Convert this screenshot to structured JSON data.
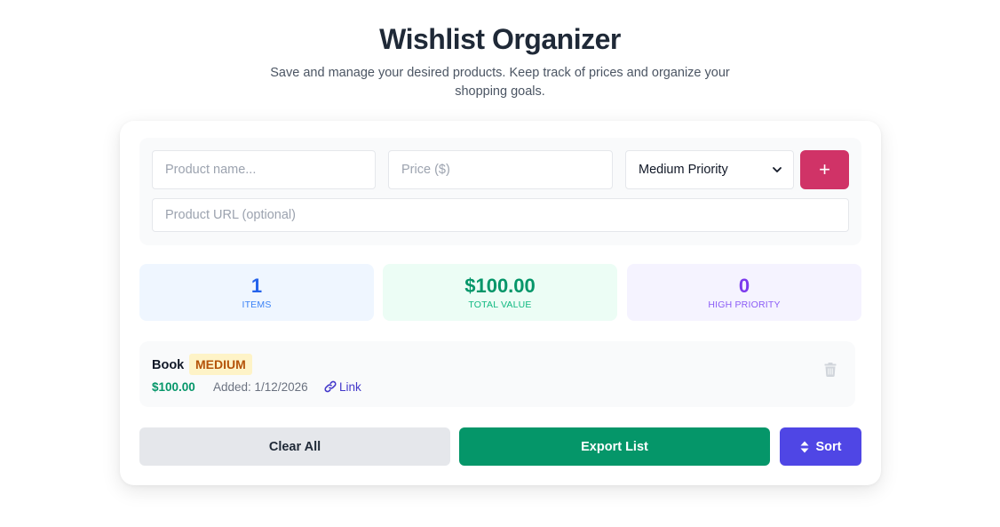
{
  "header": {
    "title": "Wishlist Organizer",
    "subtitle": "Save and manage your desired products. Keep track of prices and organize your shopping goals."
  },
  "form": {
    "name_placeholder": "Product name...",
    "price_placeholder": "Price ($)",
    "priority_selected": "Medium Priority",
    "add_label": "+",
    "url_placeholder": "Product URL (optional)"
  },
  "stats": {
    "items_value": "1",
    "items_label": "Items",
    "total_value": "$100.00",
    "total_label": "Total Value",
    "high_value": "0",
    "high_label": "High Priority"
  },
  "items": [
    {
      "name": "Book",
      "priority": "Medium",
      "price": "$100.00",
      "added": "Added: 1/12/2026",
      "link_label": "Link"
    }
  ],
  "actions": {
    "clear_label": "Clear All",
    "export_label": "Export List",
    "sort_label": "Sort"
  },
  "colors": {
    "add_button": "#d03367",
    "export_button": "#059669",
    "sort_button": "#4f46e5",
    "clear_button": "#e5e7eb"
  }
}
